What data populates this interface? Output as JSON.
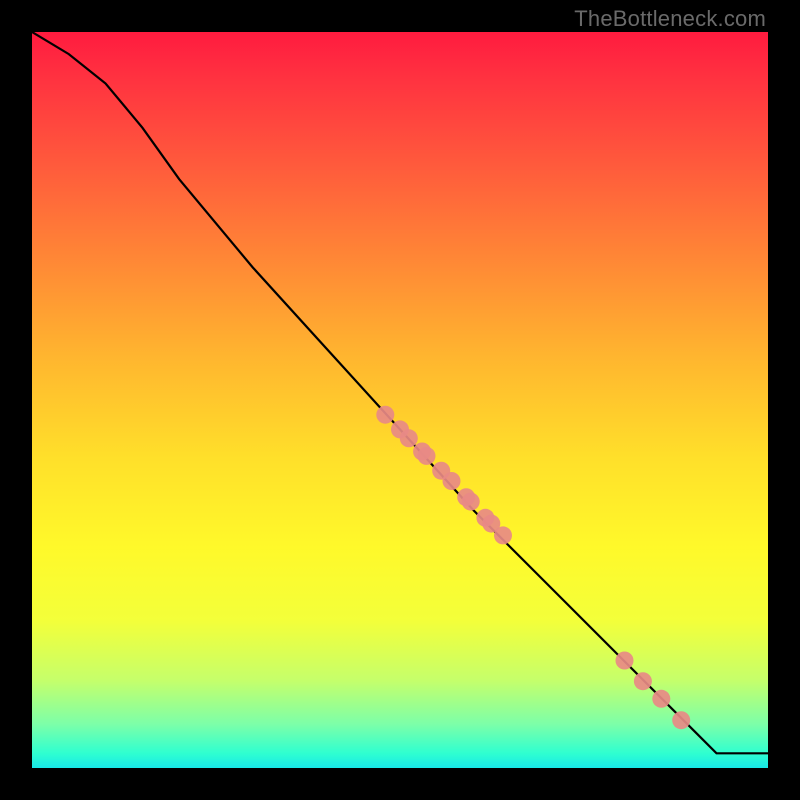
{
  "watermark": "TheBottleneck.com",
  "chart_data": {
    "type": "line",
    "title": "",
    "xlabel": "",
    "ylabel": "",
    "xlim": [
      0,
      1
    ],
    "ylim": [
      0,
      1
    ],
    "series": [
      {
        "name": "curve",
        "x": [
          0.0,
          0.05,
          0.1,
          0.15,
          0.2,
          0.3,
          0.4,
          0.5,
          0.6,
          0.7,
          0.8,
          0.9,
          0.93,
          1.0
        ],
        "y": [
          1.0,
          0.97,
          0.93,
          0.87,
          0.8,
          0.68,
          0.57,
          0.46,
          0.35,
          0.25,
          0.15,
          0.05,
          0.02,
          0.02
        ]
      }
    ],
    "markers": {
      "name": "points",
      "color": "#e88a86",
      "xy": [
        [
          0.48,
          0.48
        ],
        [
          0.5,
          0.46
        ],
        [
          0.512,
          0.448
        ],
        [
          0.53,
          0.43
        ],
        [
          0.536,
          0.424
        ],
        [
          0.556,
          0.404
        ],
        [
          0.57,
          0.39
        ],
        [
          0.59,
          0.368
        ],
        [
          0.596,
          0.362
        ],
        [
          0.616,
          0.34
        ],
        [
          0.624,
          0.332
        ],
        [
          0.64,
          0.316
        ],
        [
          0.805,
          0.146
        ],
        [
          0.83,
          0.118
        ],
        [
          0.855,
          0.094
        ],
        [
          0.882,
          0.065
        ]
      ]
    },
    "background": "rainbow_vertical_red_to_cyan"
  }
}
